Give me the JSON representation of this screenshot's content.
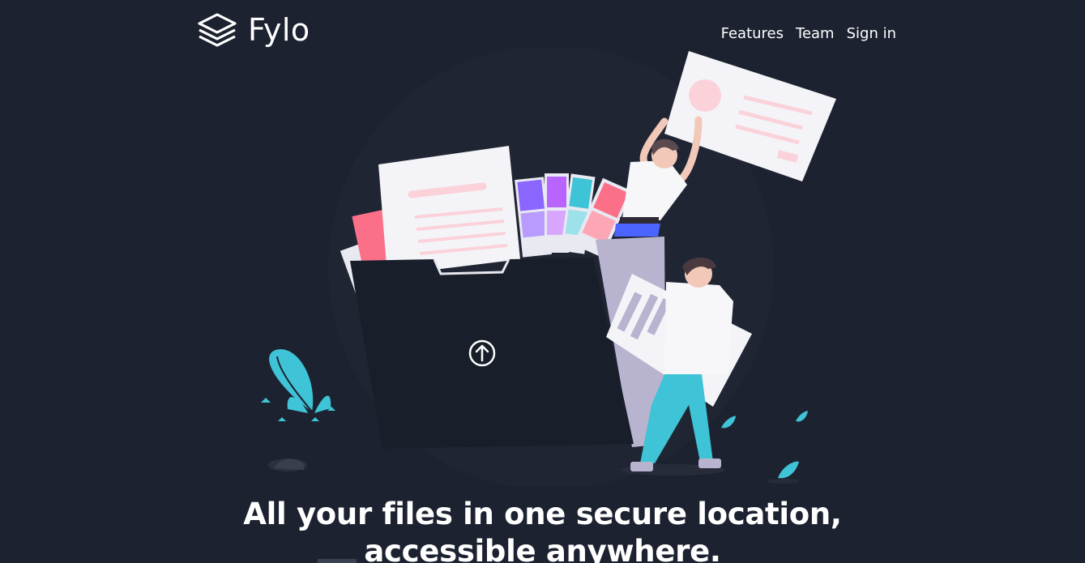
{
  "brand": {
    "name": "Fylo",
    "icon": "stacked-layers-icon"
  },
  "nav": {
    "items": [
      {
        "label": "Features"
      },
      {
        "label": "Team"
      },
      {
        "label": "Sign in"
      }
    ]
  },
  "hero": {
    "illustration_icon": "upload-arrow-icon",
    "title_line1": "All your files in one secure location,",
    "title_line2": "accessible anywhere."
  },
  "colors": {
    "background": "#1c2230",
    "text": "#ffffff",
    "folder": "#181e2a",
    "accent_cyan": "#3fc3d6",
    "accent_pink": "#fb6f89"
  }
}
